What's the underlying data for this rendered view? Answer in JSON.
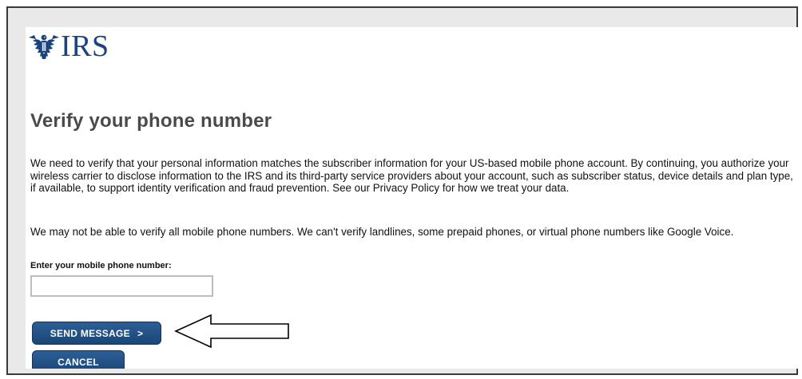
{
  "logo": {
    "text": "IRS"
  },
  "page": {
    "title": "Verify your phone number",
    "paragraph1": "We need to verify that your personal information matches the subscriber information for your US-based mobile phone account. By continuing, you authorize your wireless carrier to disclose information to the IRS and its third-party service providers about your account, such as subscriber status, device details and plan type, if available, to support identity verification and fraud prevention. See our Privacy Policy for how we treat your data.",
    "paragraph2": "We may not be able to verify all mobile phone numbers. We can't verify landlines, some prepaid phones, or virtual phone numbers like Google Voice."
  },
  "form": {
    "phone_label": "Enter your mobile phone number:",
    "phone_value": "",
    "phone_placeholder": ""
  },
  "buttons": {
    "send_label": "SEND MESSAGE",
    "send_chevron": ">",
    "cancel_label": "CANCEL"
  },
  "colors": {
    "brand_blue": "#1a4480",
    "button_blue": "#1f4a7c",
    "heading_gray": "#4a4a4a"
  },
  "icons": {
    "logo": "irs-eagle-icon",
    "annotation": "left-arrow-icon"
  }
}
